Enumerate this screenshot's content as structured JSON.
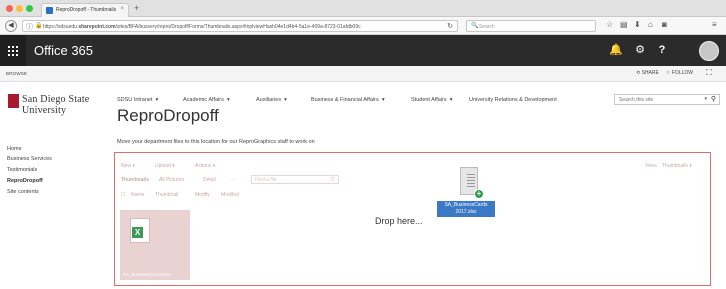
{
  "browser": {
    "tab_title": "ReproDropoff - Thumbnails",
    "tab_close": "×",
    "new_tab": "+",
    "url_prefix": "https://sdsuedu.",
    "url_domain": "sharepoint.com",
    "url_path": "/sites/BFA/bussery/repro/Dropoff/Forms/Thumbnails.aspx#InplviewHash04e1d4b4-5a1e-409a-8723-01afdb09c",
    "search_placeholder": "Search"
  },
  "suite": {
    "title": "Office 365"
  },
  "ribbon": {
    "browse": "BROWSE",
    "share": "SHARE",
    "follow": "FOLLOW"
  },
  "logo": {
    "line1": "San Diego State",
    "line2": "University"
  },
  "topnav": {
    "items": [
      "SDSU Intranet",
      "Academic Affairs",
      "Auxiliaries",
      "Business & Financial Affairs",
      "Student Affairs",
      "University Relations & Development"
    ],
    "caret": "▾",
    "search_placeholder": "Search this site"
  },
  "page": {
    "title": "ReproDropoff",
    "description": "Move your department files to this location for our ReproGraphics staff to work on"
  },
  "leftnav": {
    "items": [
      "Home",
      "Business Services",
      "Testimonials",
      "ReproDropoff",
      "Site contents"
    ],
    "selected": "ReproDropoff"
  },
  "library": {
    "commands": [
      "New",
      "Upload",
      "Actions"
    ],
    "command_caret": "▾",
    "views": [
      "Thumbnails",
      "All Pictures",
      "Detail",
      "···"
    ],
    "find_placeholder": "Find a file",
    "columns": [
      "Name",
      "Thumbnail",
      "Modify",
      "Modifed"
    ],
    "view_label": "View:",
    "view_value": "Thumbnails",
    "thumb_label": "SA_BusinessCards2017",
    "drop_text": "Drop here...",
    "drag_file_label_line1": "SA_BusinessCards",
    "drag_file_label_line2": "2017.xlsx"
  }
}
